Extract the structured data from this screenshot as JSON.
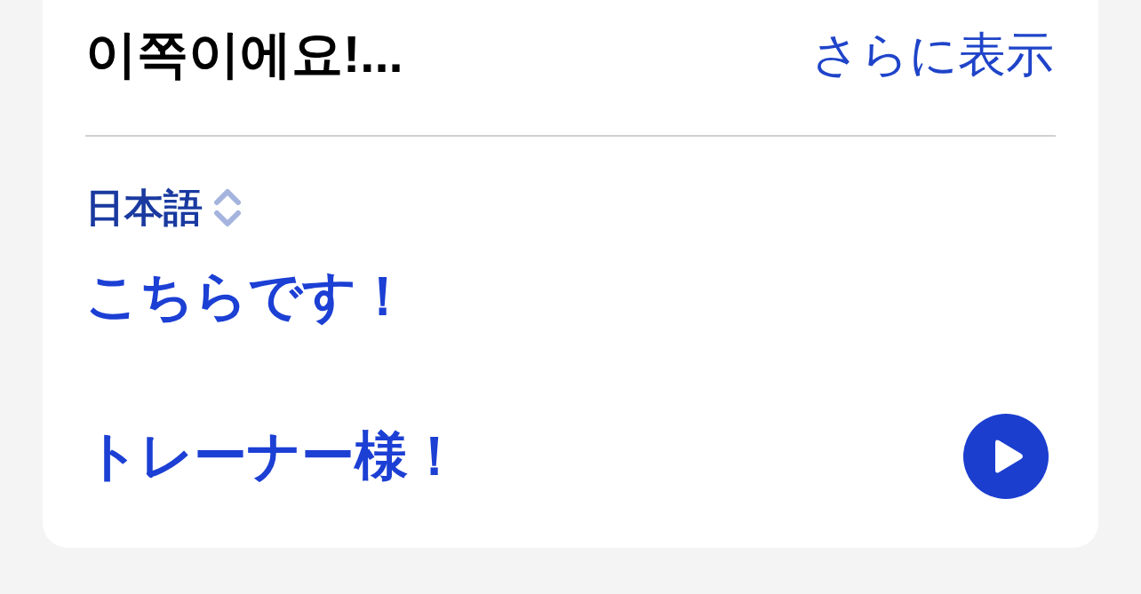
{
  "source": {
    "text": "이쪽이에요!...",
    "more_link": "さらに表示"
  },
  "translation": {
    "language": "日本語",
    "phrases": [
      "こちらです！",
      "トレーナー様！"
    ]
  }
}
